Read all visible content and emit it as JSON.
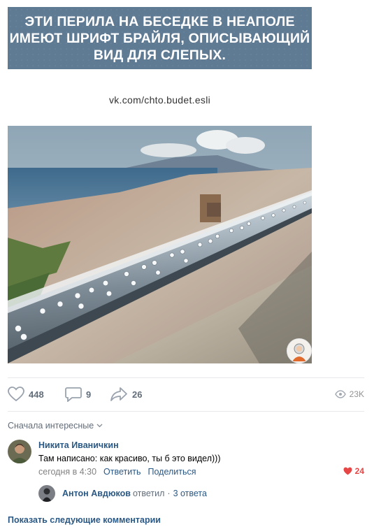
{
  "post": {
    "banner_lines": [
      "ЭТИ ПЕРИЛА НА БЕСЕДКЕ В НЕАПОЛЕ",
      "ИМЕЮТ ШРИФТ БРАЙЛЯ, ОПИСЫВАЮЩИЙ",
      "ВИД ДЛЯ СЛЕПЫХ."
    ],
    "source": "vk.com/chto.budet.esli",
    "banner_color": "#5f7a93"
  },
  "actions": {
    "likes": "448",
    "comments": "9",
    "shares": "26",
    "views": "23K"
  },
  "comments": {
    "sort_label": "Сначала интересные",
    "items": [
      {
        "author": "Никита Иваничкин",
        "text": "Там написано: как красиво, ты б это видел)))",
        "time": "сегодня в 4:30",
        "reply_label": "Ответить",
        "share_label": "Поделиться",
        "likes": "24",
        "reply": {
          "author": "Антон Авдюков",
          "verb": "ответил",
          "count": "3 ответа"
        }
      }
    ],
    "show_more": "Показать следующие комментарии"
  },
  "colors": {
    "link": "#2a5885",
    "muted": "#626d7a",
    "like_active": "#e64646"
  }
}
